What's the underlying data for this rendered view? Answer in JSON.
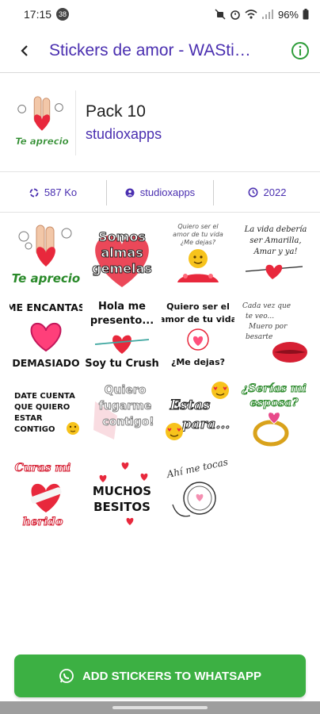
{
  "status_bar": {
    "time": "17:15",
    "notification_count": "38",
    "battery": "96%"
  },
  "app_bar": {
    "title": "Stickers de amor - WASti…"
  },
  "pack": {
    "name": "Pack 10",
    "author": "studioxapps"
  },
  "info": {
    "size": "587 Ko",
    "author": "studioxapps",
    "year": "2022"
  },
  "stickers": [
    {
      "id": "te-aprecio",
      "lines": [
        "Te aprecio"
      ]
    },
    {
      "id": "somos-almas-gemelas",
      "lines": [
        "Somos",
        "almas",
        "gemelas"
      ]
    },
    {
      "id": "quiero-ser-el-amor-emoji",
      "lines": [
        "Quiero ser el",
        "amor de tu vida",
        "¿Me dejas?"
      ]
    },
    {
      "id": "la-vida-deberia",
      "lines": [
        "La vida debería",
        "ser Amarilla,",
        "Amar y ya!"
      ]
    },
    {
      "id": "me-encantas",
      "lines": [
        "ME ENCANTAS",
        "DEMASIADO"
      ]
    },
    {
      "id": "hola-me-presento",
      "lines": [
        "Hola me",
        "presento...",
        "Soy tu Crush"
      ]
    },
    {
      "id": "quiero-ser-el-amor",
      "lines": [
        "Quiero ser el",
        "amor de tu vida",
        "¿Me dejas?"
      ]
    },
    {
      "id": "cada-vez-que-te-veo",
      "lines": [
        "Cada vez que",
        "te veo...",
        "Muero por",
        "besarte"
      ]
    },
    {
      "id": "date-cuenta",
      "lines": [
        "DATE CUENTA",
        "QUE QUIERO",
        "ESTAR",
        "CONTIGO"
      ]
    },
    {
      "id": "quiero-fugarme",
      "lines": [
        "Quiero",
        "fugarme",
        "contigo!"
      ]
    },
    {
      "id": "estas-para",
      "lines": [
        "Estas",
        "para..."
      ]
    },
    {
      "id": "serias-mi-esposa",
      "lines": [
        "¿Serías mi",
        "esposa?"
      ]
    },
    {
      "id": "curas-mi-herido",
      "lines": [
        "Curas mi",
        "herido"
      ]
    },
    {
      "id": "muchos-besitos",
      "lines": [
        "MUCHOS",
        "BESITOS"
      ]
    },
    {
      "id": "ahi-me-tocas",
      "lines": [
        "Ahí me tocas"
      ]
    }
  ],
  "add_button": {
    "label": "ADD STICKERS TO WHATSAPP"
  },
  "colors": {
    "accent": "#4a2fb0",
    "button": "#3cb043",
    "heart": "#e8283c"
  },
  "icons": {
    "back": "arrow-left-icon",
    "info": "info-circle-icon",
    "size": "circle-dash-icon",
    "author": "person-circle-icon",
    "year": "clock-icon",
    "whatsapp": "whatsapp-icon"
  }
}
